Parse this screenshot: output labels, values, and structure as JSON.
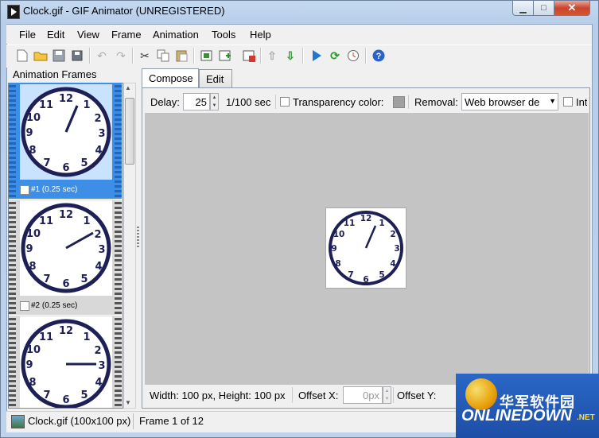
{
  "window": {
    "title": "Clock.gif - GIF Animator (UNREGISTERED)",
    "min_glyph": "▁",
    "max_glyph": "□",
    "close_glyph": "✕"
  },
  "menu": [
    "File",
    "Edit",
    "View",
    "Frame",
    "Animation",
    "Tools",
    "Help"
  ],
  "toolbar": {
    "icons": [
      "new-icon",
      "open-icon",
      "save-icon",
      "save-as-icon",
      "undo-icon",
      "redo-icon",
      "cut-icon",
      "copy-icon",
      "paste-icon",
      "add-frame-icon",
      "insert-frame-icon",
      "delete-frame-icon",
      "move-up-icon",
      "move-down-icon",
      "play-icon",
      "loop-icon",
      "timer-icon",
      "help-icon"
    ],
    "colors": {
      "accent": "#1f77d0",
      "green": "#2a9a2a",
      "red": "#d03a2a"
    }
  },
  "frames_panel": {
    "header": "Animation Frames",
    "frames": [
      {
        "caption": "#1 (0.25 sec)",
        "selected": true,
        "hour_hand": "1 o'clock",
        "minute_hand": "pointing 1"
      },
      {
        "caption": "#2 (0.25 sec)",
        "selected": false,
        "hour_hand": "2 o'clock"
      },
      {
        "caption": "",
        "selected": false,
        "hour_hand": "3 o'clock"
      }
    ],
    "clock_numbers": [
      "12",
      "1",
      "2",
      "3",
      "4",
      "5",
      "6",
      "7",
      "8",
      "9",
      "10",
      "11"
    ]
  },
  "tabs": [
    "Compose",
    "Edit"
  ],
  "compose": {
    "delay_label": "Delay:",
    "delay_value": "25",
    "delay_unit": "1/100 sec",
    "transparency_label": "Transparency color:",
    "removal_label": "Removal:",
    "removal_value": "Web browser de",
    "interlace_label": "Int",
    "size_text": "Width: 100 px, Height: 100 px",
    "offset_x_label": "Offset X:",
    "offset_x_value": "0px",
    "offset_y_label": "Offset Y:"
  },
  "status": {
    "file": "Clock.gif (100x100 px)",
    "frame": "Frame 1 of 12"
  },
  "watermark": {
    "cn": "华军软件园",
    "en": "ONLINEDOWN",
    "suffix": ".NET"
  }
}
